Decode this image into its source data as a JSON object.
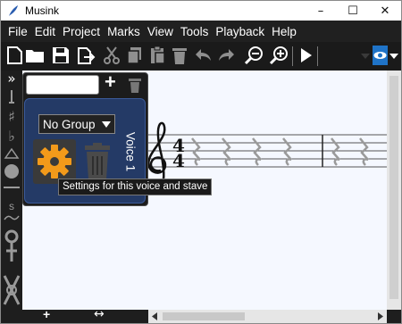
{
  "window": {
    "title": "Musink",
    "controls": [
      "minimize",
      "maximize",
      "close"
    ]
  },
  "menu": {
    "items": [
      "File",
      "Edit",
      "Project",
      "Marks",
      "View",
      "Tools",
      "Playback",
      "Help"
    ]
  },
  "toolbar": {
    "buttons": [
      {
        "name": "new-icon"
      },
      {
        "name": "open-folder-icon"
      },
      {
        "name": "save-icon"
      },
      {
        "name": "export-icon"
      },
      {
        "name": "cut-icon"
      },
      {
        "name": "copy-icon"
      },
      {
        "name": "paste-icon"
      },
      {
        "name": "delete-icon"
      },
      {
        "name": "undo-icon"
      },
      {
        "name": "redo-icon"
      },
      {
        "name": "zoom-out-icon"
      },
      {
        "name": "zoom-in-icon"
      },
      {
        "name": "play-icon"
      },
      {
        "name": "view-eye-icon"
      }
    ]
  },
  "left_strip": {
    "expand_glyph": "»",
    "flat_glyph": "♭",
    "sharp_glyph": "♯",
    "s_label": "s"
  },
  "voice_panel": {
    "name_value": "",
    "add_glyph": "+",
    "group_select": "No Group",
    "voice_label": "Voice 1",
    "tooltip": "Settings for this voice and stave"
  },
  "score": {
    "time_signature_top": "4",
    "time_signature_bottom": "4",
    "rests_measure_1": 4,
    "rests_measure_2": 2
  },
  "bottom_bar": {
    "add_glyph": "+",
    "resize_glyph": "↔"
  },
  "colors": {
    "accent_orange": "#f39a1a",
    "panel_blue": "#243a66",
    "eye_blue": "#1f73c7",
    "disabled_gray": "#8f8f8f"
  }
}
